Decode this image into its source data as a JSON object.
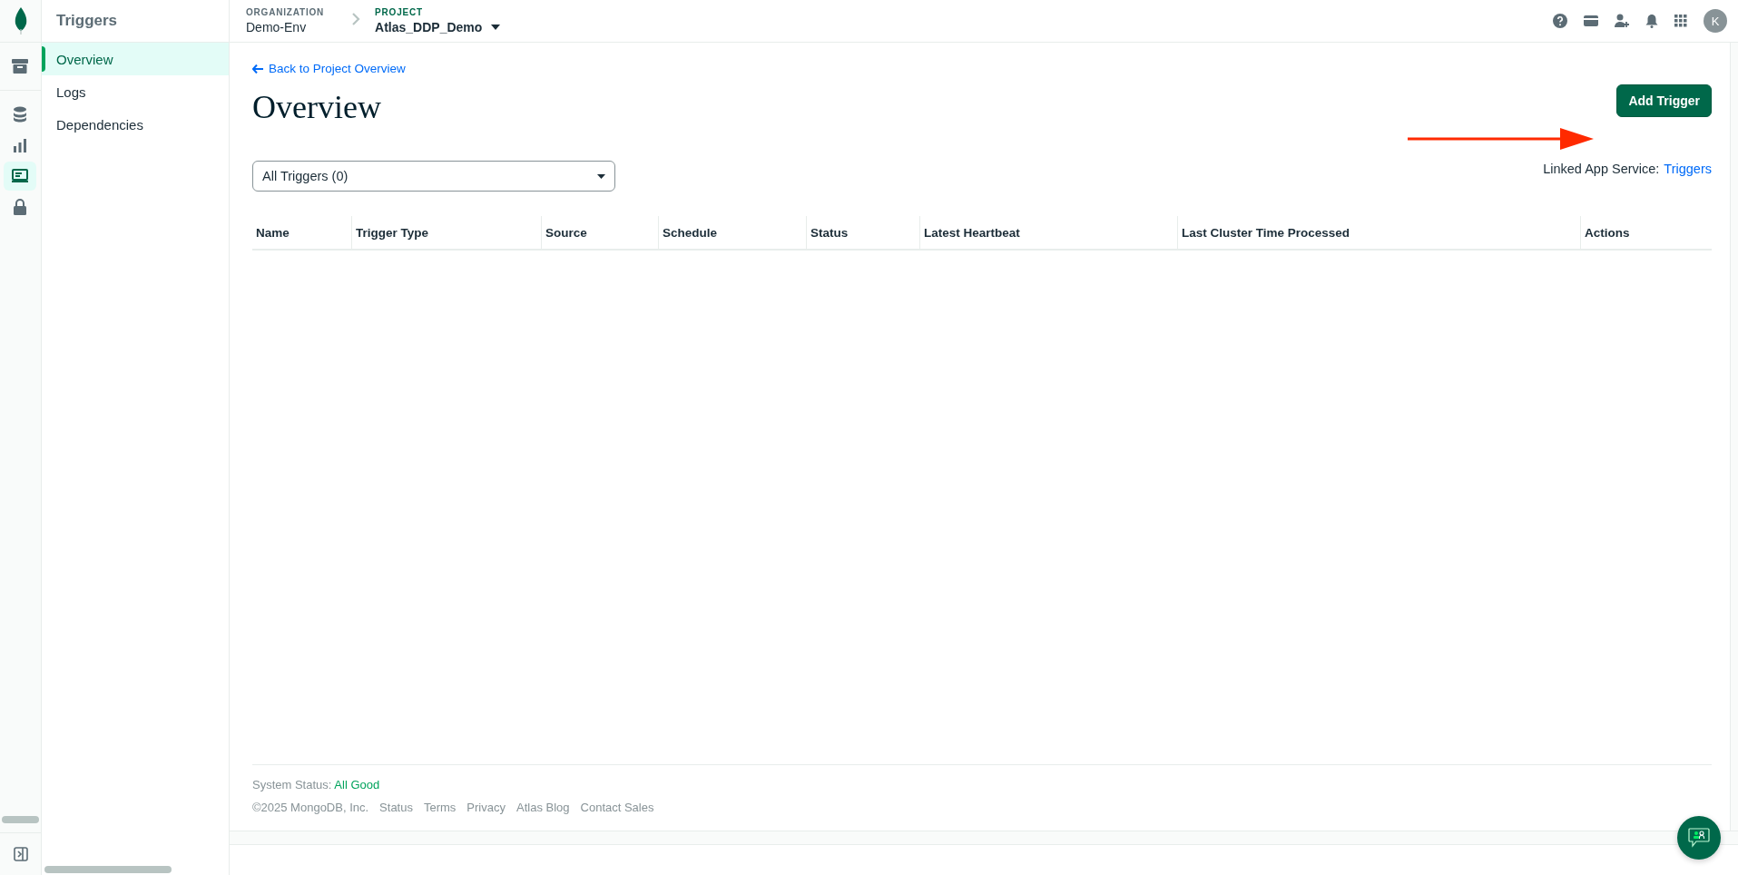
{
  "rail": [
    {
      "selected": false
    },
    {
      "selected": false
    },
    {
      "selected": false
    },
    {
      "selected": true
    },
    {
      "selected": false
    }
  ],
  "sidebar": {
    "title": "Triggers",
    "items": [
      {
        "label": "Overview",
        "selected": true
      },
      {
        "label": "Logs",
        "selected": false
      },
      {
        "label": "Dependencies",
        "selected": false
      }
    ]
  },
  "header": {
    "organization_label": "ORGANIZATION",
    "organization": "Demo-Env",
    "project_label": "PROJECT",
    "project": "Atlas_DDP_Demo",
    "avatar": "K"
  },
  "main": {
    "back_link": "Back to Project Overview",
    "title": "Overview",
    "add_button": "Add Trigger",
    "filter": "All Triggers (0)",
    "linked_label": "Linked App Service:",
    "linked_link": "Triggers",
    "table": {
      "columns": [
        "Name",
        "Trigger Type",
        "Source",
        "Schedule",
        "Status",
        "Latest Heartbeat",
        "Last Cluster Time Processed",
        "Actions"
      ]
    }
  },
  "footer": {
    "status_label": "System Status:",
    "status_value": "All Good",
    "copyright": "©2025 MongoDB, Inc.",
    "links": [
      "Status",
      "Terms",
      "Privacy",
      "Atlas Blog",
      "Contact Sales"
    ]
  }
}
